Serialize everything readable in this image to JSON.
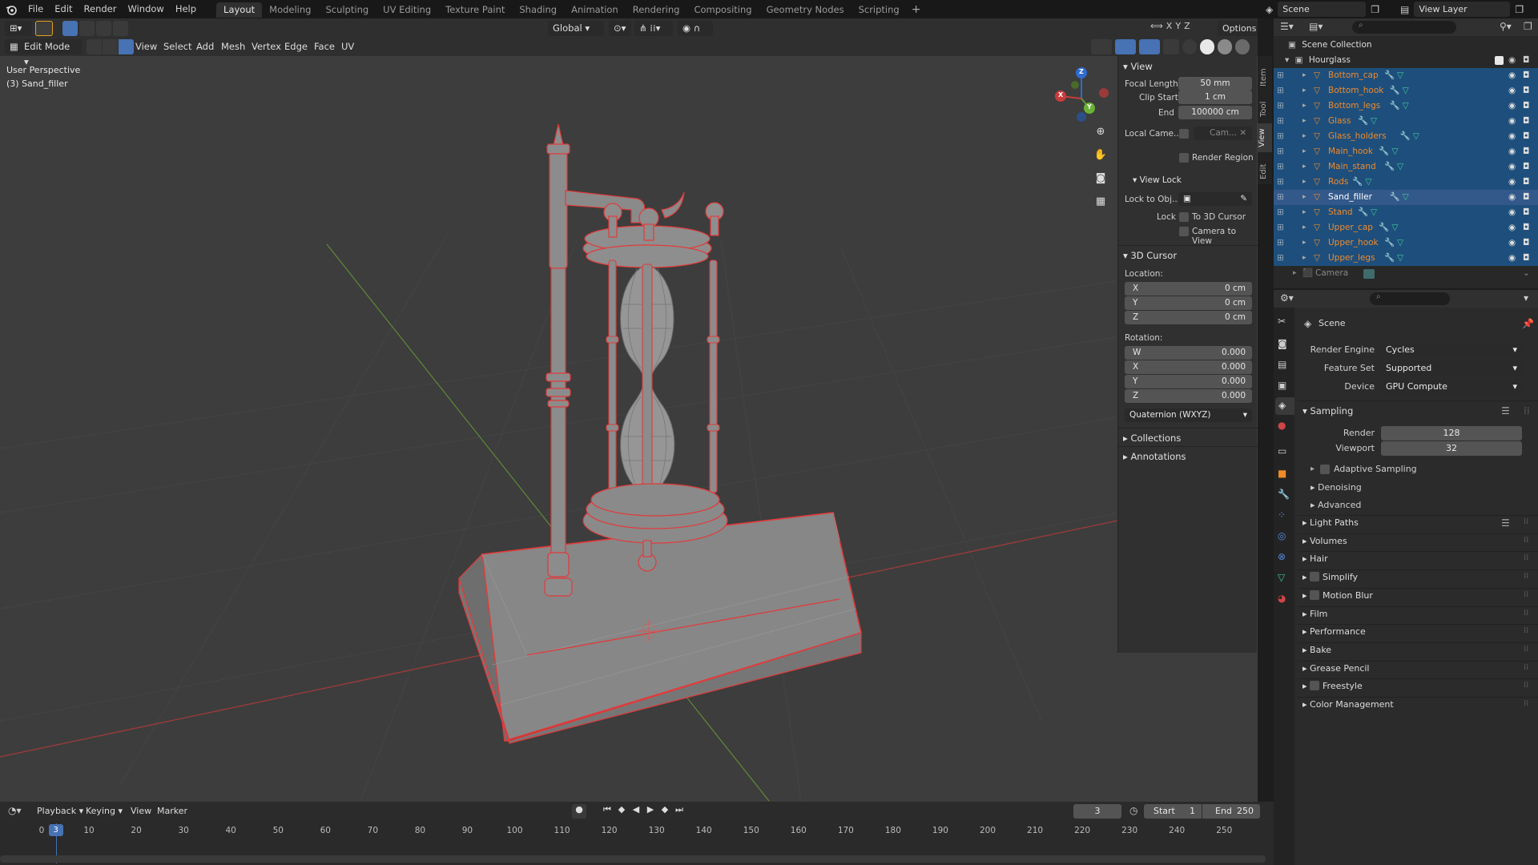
{
  "topbar": {
    "menus": [
      "File",
      "Edit",
      "Render",
      "Window",
      "Help"
    ],
    "workspaces": [
      "Layout",
      "Modeling",
      "Sculpting",
      "UV Editing",
      "Texture Paint",
      "Shading",
      "Animation",
      "Rendering",
      "Compositing",
      "Geometry Nodes",
      "Scripting"
    ],
    "active_workspace": "Layout",
    "scene_name": "Scene",
    "view_layer": "View Layer"
  },
  "viewport": {
    "mode": "Edit Mode",
    "menus": [
      "View",
      "Select",
      "Add",
      "Mesh",
      "Vertex",
      "Edge",
      "Face",
      "UV"
    ],
    "transform_orientation": "Global",
    "axis_labels": [
      "X",
      "Y",
      "Z"
    ],
    "options_label": "Options",
    "overlay_text_1": "User Perspective",
    "overlay_text_2": "(3) Sand_filler",
    "gizmo_axes": {
      "x": "X",
      "y": "Y",
      "z": "Z"
    }
  },
  "npanel": {
    "tabs": [
      "Item",
      "Tool",
      "View",
      "Edit"
    ],
    "view": {
      "title": "View",
      "focal_length_label": "Focal Length",
      "focal_length": "50 mm",
      "clip_start_label": "Clip Start",
      "clip_start": "1 cm",
      "end_label": "End",
      "clip_end": "100000 cm",
      "local_camera_label": "Local Came...",
      "local_camera_value": "Cam...",
      "render_region": "Render Region",
      "view_lock_title": "View Lock",
      "lock_to_obj_label": "Lock to Obj...",
      "lock_label": "Lock",
      "to_3d_cursor": "To 3D Cursor",
      "camera_to_view": "Camera to View"
    },
    "cursor": {
      "title": "3D Cursor",
      "location_label": "Location:",
      "location": [
        {
          "axis": "X",
          "value": "0 cm"
        },
        {
          "axis": "Y",
          "value": "0 cm"
        },
        {
          "axis": "Z",
          "value": "0 cm"
        }
      ],
      "rotation_label": "Rotation:",
      "rotation": [
        {
          "axis": "W",
          "value": "0.000"
        },
        {
          "axis": "X",
          "value": "0.000"
        },
        {
          "axis": "Y",
          "value": "0.000"
        },
        {
          "axis": "Z",
          "value": "0.000"
        }
      ],
      "rotation_mode": "Quaternion (WXYZ)"
    },
    "collections": "Collections",
    "annotations": "Annotations"
  },
  "outliner": {
    "root": "Scene Collection",
    "collection": "Hourglass",
    "objects": [
      "Bottom_cap",
      "Bottom_hook",
      "Bottom_legs",
      "Glass",
      "Glass_holders",
      "Main_hook",
      "Main_stand",
      "Rods",
      "Sand_filler",
      "Stand",
      "Upper_cap",
      "Upper_hook",
      "Upper_legs"
    ],
    "active_object": "Sand_filler",
    "camera": "Camera"
  },
  "properties": {
    "context": "Scene",
    "render_engine_label": "Render Engine",
    "render_engine": "Cycles",
    "feature_set_label": "Feature Set",
    "feature_set": "Supported",
    "device_label": "Device",
    "device": "GPU Compute",
    "sampling": "Sampling",
    "render_label": "Render",
    "render_samples": "128",
    "viewport_label": "Viewport",
    "viewport_samples": "32",
    "adaptive_sampling": "Adaptive Sampling",
    "denoising": "Denoising",
    "advanced": "Advanced",
    "sections": [
      "Light Paths",
      "Volumes",
      "Hair",
      "Simplify",
      "Motion Blur",
      "Film",
      "Performance",
      "Bake",
      "Grease Pencil",
      "Freestyle",
      "Color Management"
    ]
  },
  "timeline": {
    "menus": [
      "Playback",
      "Keying",
      "View",
      "Marker"
    ],
    "current_frame": "3",
    "start_label": "Start",
    "start": "1",
    "end_label": "End",
    "end": "250",
    "ruler": [
      "0",
      "10",
      "20",
      "30",
      "40",
      "50",
      "60",
      "70",
      "80",
      "90",
      "100",
      "110",
      "120",
      "130",
      "140",
      "150",
      "160",
      "170",
      "180",
      "190",
      "200",
      "210",
      "220",
      "230",
      "240",
      "250"
    ]
  },
  "colors": {
    "accent": "#4772b3",
    "selection": "#1e4f7c",
    "object_orange": "#f08a2a",
    "edge_red": "#e23a3a"
  }
}
